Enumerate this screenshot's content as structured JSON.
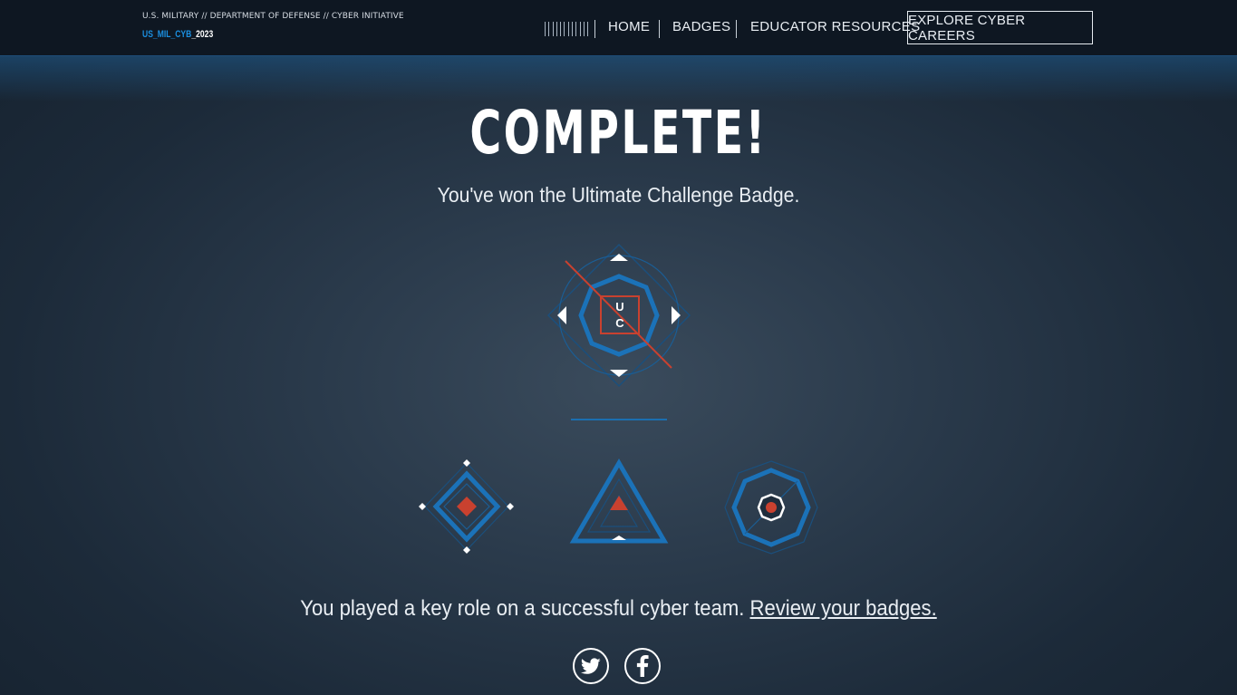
{
  "header": {
    "brand_top": "U.S. MILITARY // DEPARTMENT OF DEFENSE // CYBER INITIATIVE",
    "brand_code_a": "US_MIL_CYB",
    "brand_code_b": "_2023",
    "nav": {
      "home": "HOME",
      "badges": "BADGES",
      "educator": "EDUCATOR RESOURCES"
    },
    "cta": "EXPLORE CYBER CAREERS"
  },
  "main": {
    "title": "COMPLETE!",
    "subtitle": "You've won the Ultimate Challenge Badge.",
    "badge_letters": {
      "top": "U",
      "bottom": "C"
    },
    "message": "You played a key role on a successful cyber team.",
    "review_link": "Review your badges."
  },
  "icons": {
    "nav_bars": "bars-icon",
    "twitter": "twitter-icon",
    "facebook": "facebook-icon"
  },
  "colors": {
    "accent_blue": "#1b72b8",
    "accent_red": "#c9412f"
  }
}
